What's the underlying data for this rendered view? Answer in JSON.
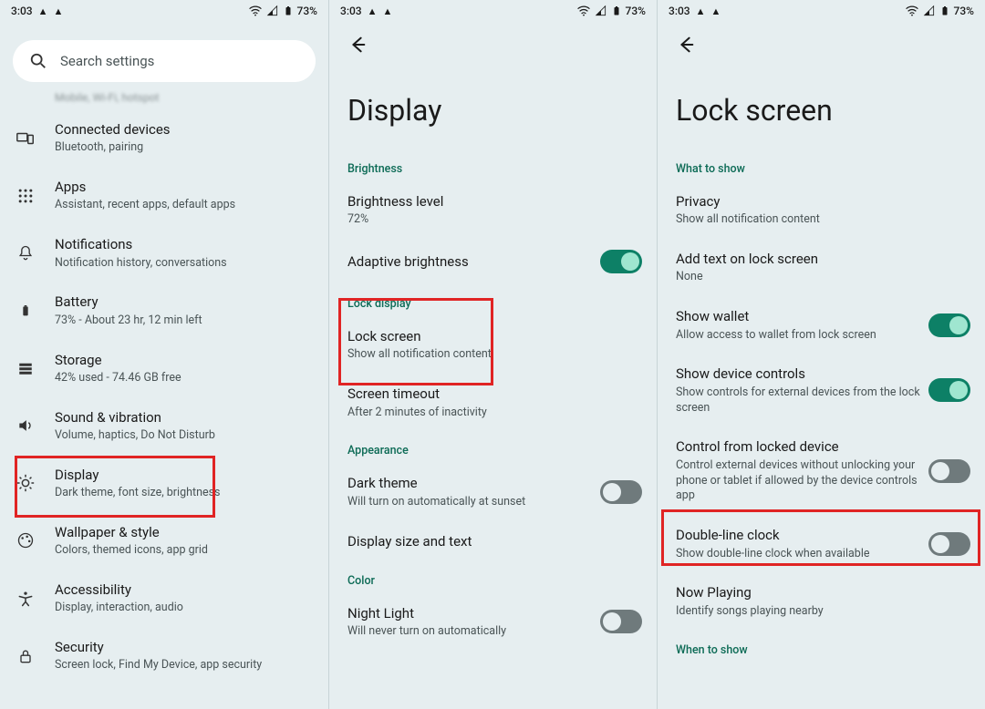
{
  "status": {
    "time": "3:03",
    "battery": "73%"
  },
  "pane1": {
    "search": {
      "placeholder": "Search settings"
    },
    "truncated_sub": "Mobile, Wi-Fi, hotspot",
    "items": [
      {
        "icon": "devices",
        "title": "Connected devices",
        "sub": "Bluetooth, pairing"
      },
      {
        "icon": "apps",
        "title": "Apps",
        "sub": "Assistant, recent apps, default apps"
      },
      {
        "icon": "bell",
        "title": "Notifications",
        "sub": "Notification history, conversations"
      },
      {
        "icon": "battery",
        "title": "Battery",
        "sub": "73% - About 23 hr, 12 min left"
      },
      {
        "icon": "storage",
        "title": "Storage",
        "sub": "42% used - 74.46 GB free"
      },
      {
        "icon": "volume",
        "title": "Sound & vibration",
        "sub": "Volume, haptics, Do Not Disturb"
      },
      {
        "icon": "brightness",
        "title": "Display",
        "sub": "Dark theme, font size, brightness"
      },
      {
        "icon": "palette",
        "title": "Wallpaper & style",
        "sub": "Colors, themed icons, app grid"
      },
      {
        "icon": "accessibility",
        "title": "Accessibility",
        "sub": "Display, interaction, audio"
      },
      {
        "icon": "lock",
        "title": "Security",
        "sub": "Screen lock, Find My Device, app security"
      }
    ]
  },
  "pane2": {
    "title": "Display",
    "sections": {
      "brightness": {
        "label": "Brightness",
        "items": [
          {
            "title": "Brightness level",
            "sub": "72%"
          },
          {
            "title": "Adaptive brightness",
            "toggle": "on"
          }
        ]
      },
      "lock": {
        "label": "Lock display",
        "items": [
          {
            "title": "Lock screen",
            "sub": "Show all notification content"
          },
          {
            "title": "Screen timeout",
            "sub": "After 2 minutes of inactivity"
          }
        ]
      },
      "appearance": {
        "label": "Appearance",
        "items": [
          {
            "title": "Dark theme",
            "sub": "Will turn on automatically at sunset",
            "toggle": "off"
          },
          {
            "title": "Display size and text"
          }
        ]
      },
      "color": {
        "label": "Color",
        "items": [
          {
            "title": "Night Light",
            "sub": "Will never turn on automatically",
            "toggle": "off"
          }
        ]
      }
    }
  },
  "pane3": {
    "title": "Lock screen",
    "sections": {
      "what": {
        "label": "What to show",
        "items": [
          {
            "title": "Privacy",
            "sub": "Show all notification content"
          },
          {
            "title": "Add text on lock screen",
            "sub": "None"
          },
          {
            "title": "Show wallet",
            "sub": "Allow access to wallet from lock screen",
            "toggle": "on"
          },
          {
            "title": "Show device controls",
            "sub": "Show controls for external devices from the lock screen",
            "toggle": "on"
          },
          {
            "title": "Control from locked device",
            "sub": "Control external devices without unlocking your phone or tablet if allowed by the device controls app",
            "toggle": "off"
          },
          {
            "title": "Double-line clock",
            "sub": "Show double-line clock when available",
            "toggle": "off"
          },
          {
            "title": "Now Playing",
            "sub": "Identify songs playing nearby"
          }
        ]
      },
      "when": {
        "label": "When to show"
      }
    }
  }
}
